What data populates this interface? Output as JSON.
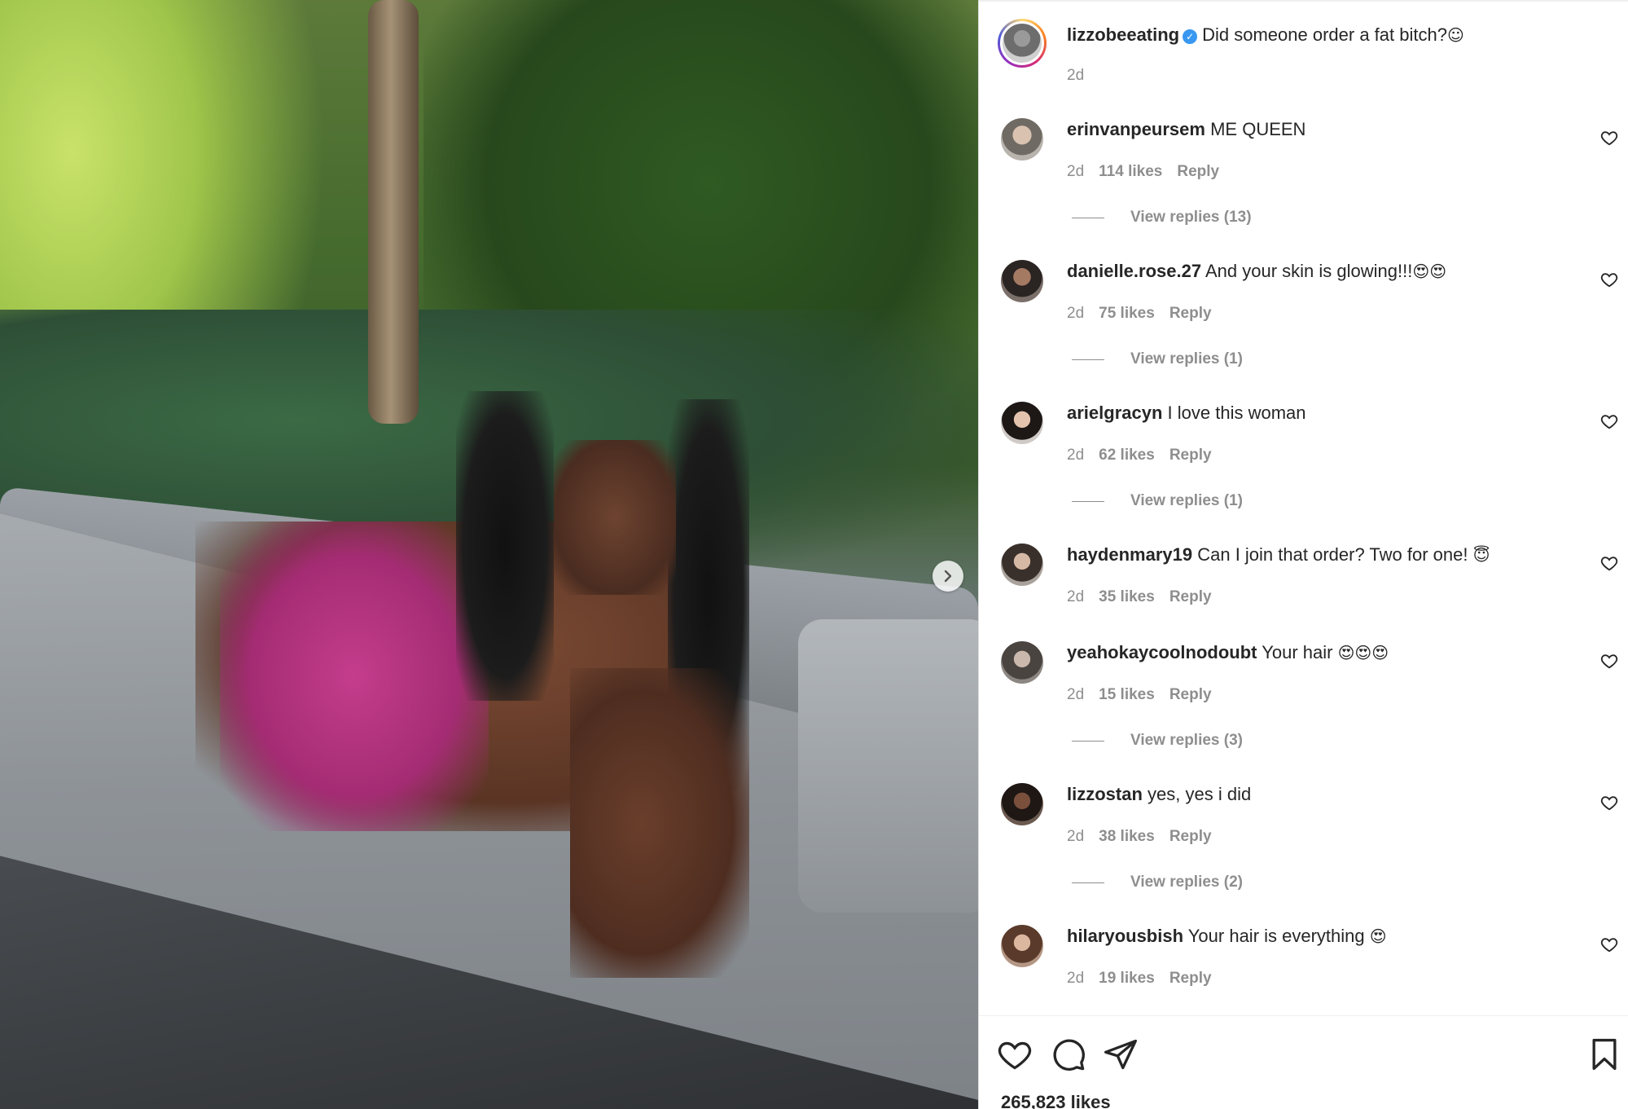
{
  "post": {
    "username": "lizzobeeating",
    "caption": "Did someone order a fat bitch?",
    "caption_emoji": "☺",
    "time": "2d",
    "likes": "265,823 likes"
  },
  "icons": {
    "verified": "verified-badge-icon",
    "heart": "heart-icon",
    "comment": "comment-icon",
    "share": "paper-plane-icon",
    "save": "bookmark-icon",
    "next": "chevron-right-icon"
  },
  "colors": {
    "verified_blue": "#3897f0",
    "meta_grey": "#8e8e8e",
    "text": "#262626"
  },
  "comments": [
    {
      "username": "erinvanpeursem",
      "text": "ME QUEEN",
      "emoji": "",
      "time": "2d",
      "likes": "114 likes",
      "reply": "Reply",
      "view_replies": "View replies (13)"
    },
    {
      "username": "danielle.rose.27",
      "text": "And your skin is glowing!!!",
      "emoji": "😍😍",
      "time": "2d",
      "likes": "75 likes",
      "reply": "Reply",
      "view_replies": "View replies (1)"
    },
    {
      "username": "arielgracyn",
      "text": "I love this woman",
      "emoji": "",
      "time": "2d",
      "likes": "62 likes",
      "reply": "Reply",
      "view_replies": "View replies (1)"
    },
    {
      "username": "haydenmary19",
      "text": "Can I join that order? Two for one!",
      "emoji": "😇",
      "time": "2d",
      "likes": "35 likes",
      "reply": "Reply",
      "view_replies": ""
    },
    {
      "username": "yeahokaycoolnodoubt",
      "text": "Your hair",
      "emoji": "😍😍😍",
      "time": "2d",
      "likes": "15 likes",
      "reply": "Reply",
      "view_replies": "View replies (3)"
    },
    {
      "username": "lizzostan",
      "text": "yes, yes i did",
      "emoji": "",
      "time": "2d",
      "likes": "38 likes",
      "reply": "Reply",
      "view_replies": "View replies (2)"
    },
    {
      "username": "hilaryousbish",
      "text": "Your hair is everything",
      "emoji": "😍",
      "time": "2d",
      "likes": "19 likes",
      "reply": "Reply",
      "view_replies": ""
    }
  ]
}
